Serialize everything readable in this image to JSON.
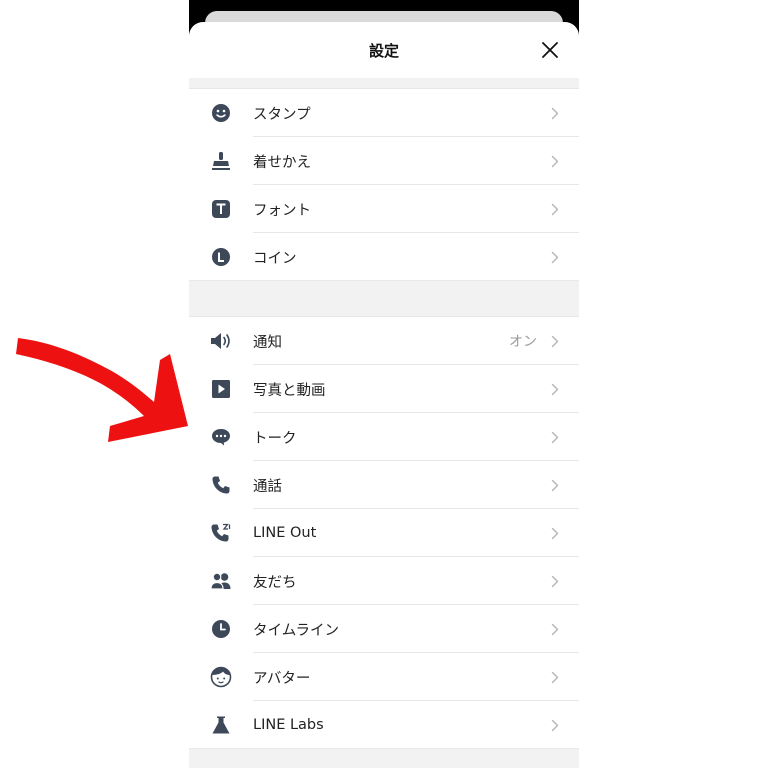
{
  "header": {
    "title": "設定"
  },
  "section1": [
    {
      "label": "スタンプ",
      "icon": "smiley-icon"
    },
    {
      "label": "着せかえ",
      "icon": "stamp-icon"
    },
    {
      "label": "フォント",
      "icon": "font-icon"
    },
    {
      "label": "コイン",
      "icon": "coin-icon"
    }
  ],
  "section2": [
    {
      "label": "通知",
      "value": "オン",
      "icon": "speaker-icon"
    },
    {
      "label": "写真と動画",
      "icon": "play-icon"
    },
    {
      "label": "トーク",
      "icon": "chat-bubble-icon"
    },
    {
      "label": "通話",
      "icon": "phone-icon"
    },
    {
      "label": "LINE Out",
      "icon": "phone-out-icon"
    },
    {
      "label": "友だち",
      "icon": "friends-icon"
    },
    {
      "label": "タイムライン",
      "icon": "clock-icon"
    },
    {
      "label": "アバター",
      "icon": "avatar-face-icon"
    },
    {
      "label": "LINE Labs",
      "icon": "flask-icon"
    }
  ],
  "colors": {
    "icon": "#3d4859",
    "chevron": "#b8b8b8",
    "arrow": "#ee1111"
  }
}
